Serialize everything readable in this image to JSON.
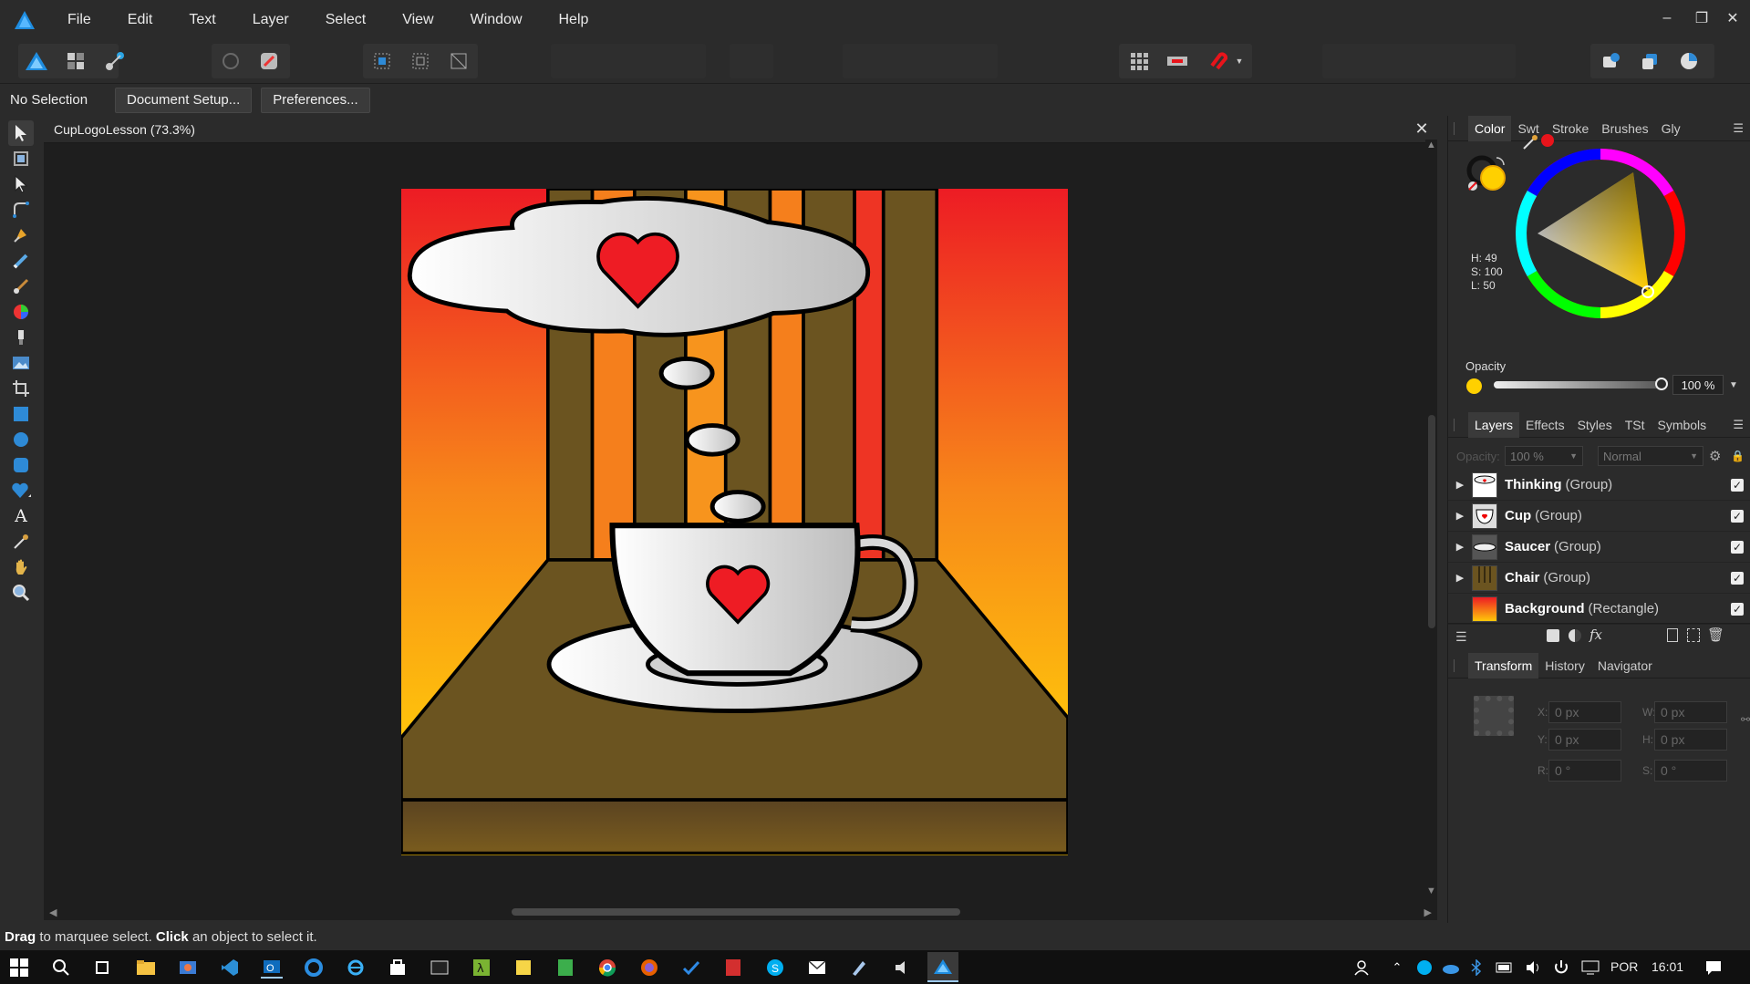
{
  "menubar": {
    "items": [
      "File",
      "Edit",
      "Text",
      "Layer",
      "Select",
      "View",
      "Window",
      "Help"
    ]
  },
  "context": {
    "selection_label": "No Selection",
    "document_setup": "Document Setup...",
    "preferences": "Preferences..."
  },
  "document": {
    "tab_title": "CupLogoLesson (73.3%)",
    "close_glyph": "✕"
  },
  "color_panel": {
    "tabs": [
      "Color",
      "Swt",
      "Stroke",
      "Brushes",
      "Gly"
    ],
    "h": "H: 49",
    "s": "S: 100",
    "l": "L: 50",
    "opacity_label": "Opacity",
    "opacity_value": "100 %",
    "fill_color": "#ffd000",
    "accent": "#e8141b"
  },
  "layers_panel": {
    "tabs": [
      "Layers",
      "Effects",
      "Styles",
      "TSt",
      "Symbols"
    ],
    "opacity_label": "Opacity:",
    "opacity_value": "100 %",
    "blend_mode": "Normal",
    "layers": [
      {
        "name": "Thinking",
        "type": "(Group)"
      },
      {
        "name": "Cup",
        "type": "(Group)"
      },
      {
        "name": "Saucer",
        "type": "(Group)"
      },
      {
        "name": "Chair",
        "type": "(Group)"
      },
      {
        "name": "Background",
        "type": "(Rectangle)"
      }
    ]
  },
  "transform_panel": {
    "tabs": [
      "Transform",
      "History",
      "Navigator"
    ],
    "x_label": "X:",
    "x_value": "0 px",
    "y_label": "Y:",
    "y_value": "0 px",
    "w_label": "W:",
    "w_value": "0 px",
    "h_label": "H:",
    "h_value": "0 px",
    "r_label": "R:",
    "r_value": "0 °",
    "s_label": "S:",
    "s_value": "0 °"
  },
  "status": {
    "drag": "Drag",
    "text1": " to marquee select. ",
    "click": "Click",
    "text2": " an object to select it."
  },
  "taskbar": {
    "language": "POR",
    "time": "16:01"
  }
}
